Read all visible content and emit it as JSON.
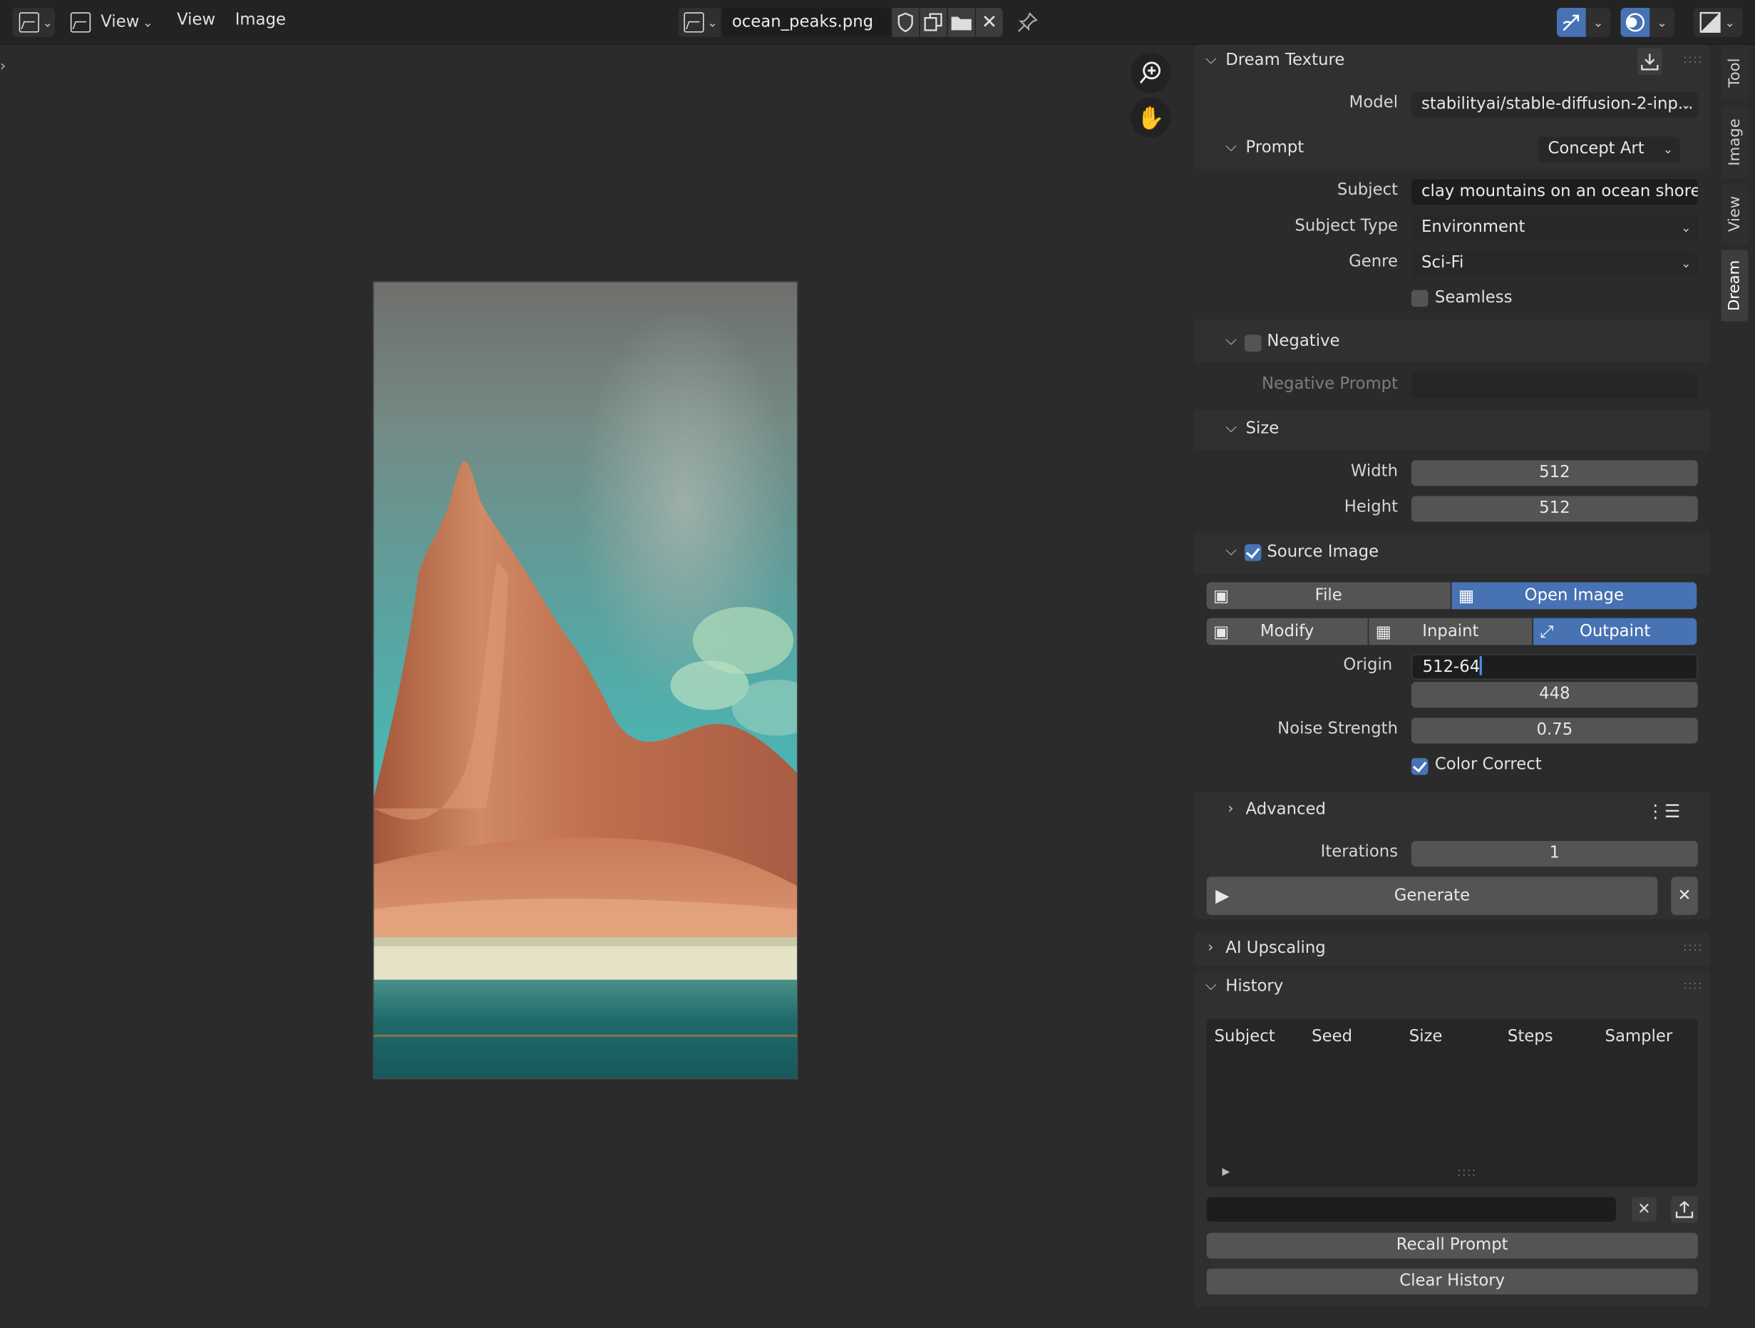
{
  "header": {
    "editor_type_icon": "image-editor-icon",
    "view_label": "View",
    "menu_view": "View",
    "menu_image": "Image",
    "image_browse_icon": "image-icon",
    "filename": "ocean_peaks.png",
    "fake_user_icon": "shield-icon",
    "duplicate_icon": "duplicate-icon",
    "open_icon": "folder-icon",
    "unlink_icon": "close-icon",
    "pin_icon": "pin-icon",
    "gizmo_icon": "gizmo-icon",
    "overlay_icon": "overlay-icon",
    "display_icon": "display-channels-icon"
  },
  "viewport": {
    "zoom_icon": "zoom-icon",
    "pan_icon": "hand-icon",
    "image_alt": "ocean peaks generated image"
  },
  "panel": {
    "dream_texture": {
      "title": "Dream Texture",
      "download_icon": "download-icon",
      "model_label": "Model",
      "model_value": "stabilityai/stable-diffusion-2-inp..."
    },
    "prompt": {
      "title": "Prompt",
      "preset": "Concept Art",
      "subject_label": "Subject",
      "subject_value": "clay mountains on an ocean shore",
      "subject_type_label": "Subject Type",
      "subject_type_value": "Environment",
      "genre_label": "Genre",
      "genre_value": "Sci-Fi",
      "seamless_label": "Seamless",
      "seamless_checked": false
    },
    "negative": {
      "title": "Negative",
      "checked": false,
      "prompt_label": "Negative Prompt",
      "prompt_value": ""
    },
    "size": {
      "title": "Size",
      "width_label": "Width",
      "width_value": "512",
      "height_label": "Height",
      "height_value": "512"
    },
    "source_image": {
      "title": "Source Image",
      "checked": true,
      "file_label": "File",
      "open_image_label": "Open Image",
      "modify_label": "Modify",
      "inpaint_label": "Inpaint",
      "outpaint_label": "Outpaint",
      "origin_label": "Origin",
      "origin_x": "512-64",
      "origin_y": "448",
      "noise_label": "Noise Strength",
      "noise_value": "0.75",
      "color_correct_label": "Color Correct",
      "color_correct_checked": true
    },
    "advanced": {
      "title": "Advanced",
      "list_icon": "list-icon",
      "iterations_label": "Iterations",
      "iterations_value": "1",
      "generate_label": "Generate",
      "play_icon": "play-icon",
      "cancel_icon": "close-icon"
    },
    "ai_upscaling": {
      "title": "AI Upscaling"
    },
    "history": {
      "title": "History",
      "columns": [
        "Subject",
        "Seed",
        "Size",
        "Steps",
        "Sampler"
      ],
      "filter_value": "",
      "remove_icon": "close-icon",
      "export_icon": "export-icon",
      "recall_label": "Recall Prompt",
      "clear_label": "Clear History"
    }
  },
  "tabs": [
    "Tool",
    "Image",
    "View",
    "Dream"
  ],
  "active_tab": "Dream",
  "colors": {
    "accent": "#4772b3",
    "background": "#2b2b2b",
    "panel": "#303030",
    "field": "#1d1d1d",
    "button": "#545454"
  }
}
